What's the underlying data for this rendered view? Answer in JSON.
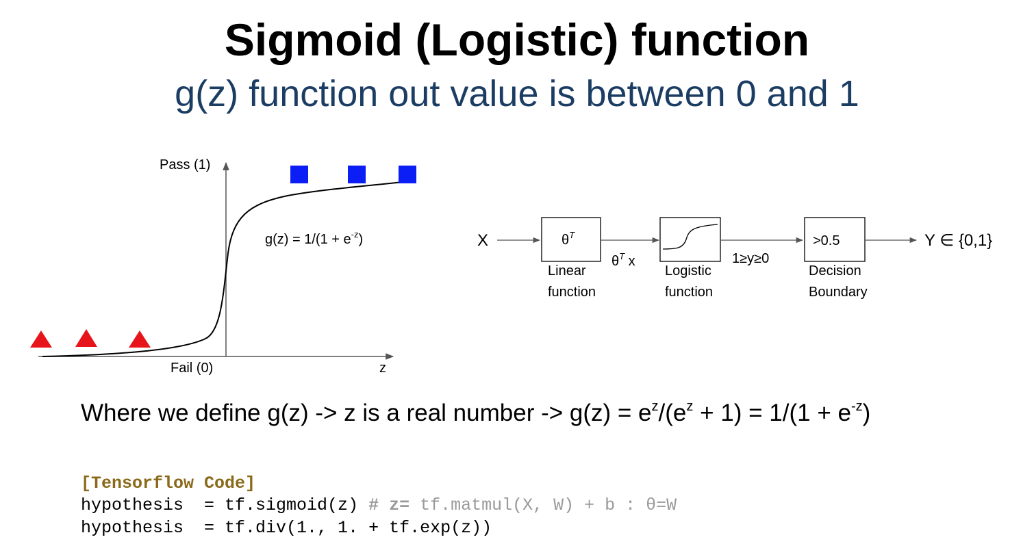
{
  "title": "Sigmoid (Logistic) function",
  "subtitle": "g(z) function out value is between 0 and 1",
  "plot": {
    "y_top_label": "Pass (1)",
    "y_bottom_label": "Fail (0)",
    "x_label": "z",
    "formula_prefix": "g(z) = 1/(1 + e",
    "formula_exp": "-z",
    "formula_suffix": ")",
    "triangle_color": "#e8141b",
    "square_color": "#0a1ef5"
  },
  "pipeline": {
    "input": "X",
    "box1_base": "θ",
    "box1_sup": "T",
    "box1_caption_line1": "Linear",
    "box1_caption_line2": "function",
    "edge1_base": "θ",
    "edge1_sup": "T",
    "edge1_suffix": " x",
    "box2_caption_line1": "Logistic",
    "box2_caption_line2": "function",
    "edge2": "1≥y≥0",
    "box3_text": ">0.5",
    "box3_caption_line1": "Decision",
    "box3_caption_line2": "Boundary",
    "output": "Y ∈ {0,1}"
  },
  "definition": {
    "part1": "Where we define g(z) -> z is a real number -> g(z) = e",
    "exp1": "z",
    "part2": "/(e",
    "exp2": "z",
    "part3": " + 1) = 1/(1 + e",
    "exp3": "-z",
    "part4": ")"
  },
  "code": {
    "header": "[Tensorflow Code]",
    "line1_code": "hypothesis  = tf.sigmoid(z) ",
    "line1_hash": "# ",
    "line1_var": "z=",
    "line1_comment": " tf.matmul(X, W) + b : θ=W",
    "line2_code": "hypothesis  = tf.div(1., 1. + tf.exp(z))"
  }
}
